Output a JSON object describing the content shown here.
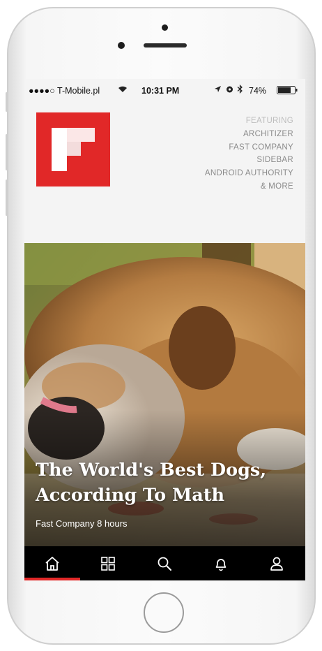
{
  "status_bar": {
    "carrier": "●●●●○ T-Mobile.pl",
    "time": "10:31 PM",
    "battery": "74%"
  },
  "header": {
    "logo_name": "flipboard-logo",
    "featuring_label": "FEATURING",
    "featured_sources": [
      "ARCHITIZER",
      "FAST COMPANY",
      "SIDEBAR",
      "ANDROID AUTHORITY",
      "& MORE"
    ]
  },
  "story": {
    "headline_line1": "The World's Best Dogs,",
    "headline_line2": "According To Math",
    "source": "Fast Company",
    "age": "8 hours"
  },
  "tabs": [
    {
      "name": "home-icon",
      "active": true
    },
    {
      "name": "grid-icon",
      "active": false
    },
    {
      "name": "search-icon",
      "active": false
    },
    {
      "name": "bell-icon",
      "active": false
    },
    {
      "name": "profile-icon",
      "active": false
    }
  ],
  "colors": {
    "accent": "#e12828",
    "header_bg": "#f4f4f4",
    "tabbar_bg": "#000000"
  }
}
